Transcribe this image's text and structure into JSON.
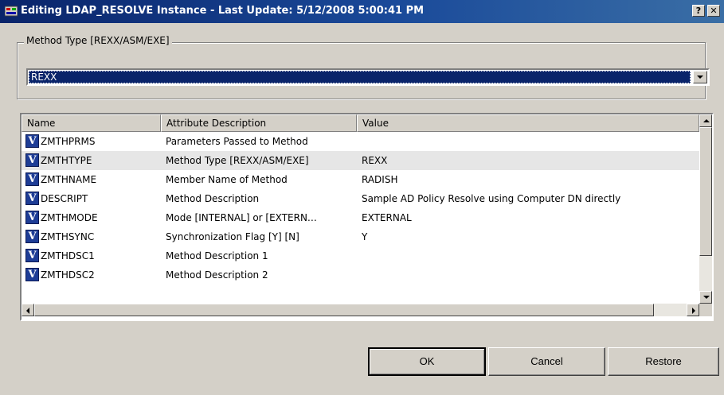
{
  "window": {
    "title": "Editing LDAP_RESOLVE Instance - Last Update: 5/12/2008 5:00:41 PM",
    "help_button": "?",
    "close_button": "✕"
  },
  "method_type": {
    "group_label": "Method Type [REXX/ASM/EXE]",
    "selected_value": "REXX"
  },
  "list": {
    "columns": [
      "Name",
      "Attribute Description",
      "Value"
    ],
    "rows": [
      {
        "name": "ZMTHPRMS",
        "description": "Parameters Passed to Method",
        "value": ""
      },
      {
        "name": "ZMTHTYPE",
        "description": "Method Type [REXX/ASM/EXE]",
        "value": "REXX"
      },
      {
        "name": "ZMTHNAME",
        "description": "Member Name of Method",
        "value": "RADISH"
      },
      {
        "name": "DESCRIPT",
        "description": "Method Description",
        "value": "Sample AD Policy Resolve using Computer DN directly"
      },
      {
        "name": "ZMTHMODE",
        "description": "Mode [INTERNAL] or [EXTERN…",
        "value": "EXTERNAL"
      },
      {
        "name": "ZMTHSYNC",
        "description": "Synchronization Flag [Y] [N]",
        "value": "Y"
      },
      {
        "name": "ZMTHDSC1",
        "description": "Method Description 1",
        "value": ""
      },
      {
        "name": "ZMTHDSC2",
        "description": "Method Description 2",
        "value": ""
      }
    ],
    "row_icon_glyph": "V",
    "row_icon": "variable-icon",
    "selected_row_index": 1
  },
  "buttons": {
    "ok": "OK",
    "cancel": "Cancel",
    "restore": "Restore"
  },
  "colors": {
    "title_bar": "#0a246a",
    "selection": "#0a246a",
    "dialog_bg": "#d4d0c8",
    "row_icon_bg": "#1e3d96"
  }
}
